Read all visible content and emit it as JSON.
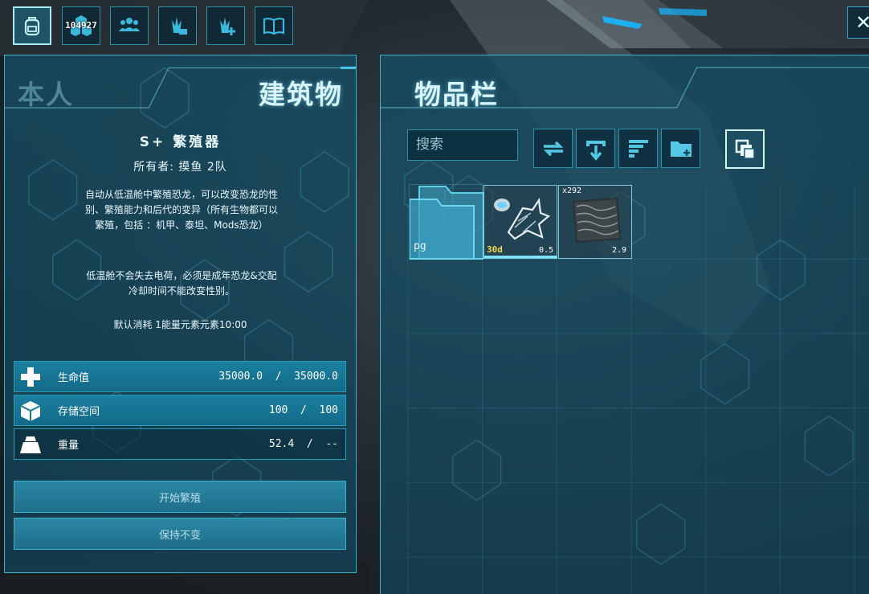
{
  "topbar": {
    "buttons": [
      {
        "name": "inventory-button",
        "icon": "backpack-icon",
        "active": true
      },
      {
        "name": "level-button",
        "icon": "hexagons-icon",
        "text": "104927"
      },
      {
        "name": "tribe-button",
        "icon": "group-icon"
      },
      {
        "name": "tames-button",
        "icon": "plant-folder-icon"
      },
      {
        "name": "engram-button",
        "icon": "plant-plus-icon"
      },
      {
        "name": "notes-button",
        "icon": "book-icon"
      }
    ],
    "close_label": "✕"
  },
  "left_panel": {
    "tab_self": "本人",
    "tab_structure": "建筑物",
    "structure_name": "S+   繁殖器",
    "owner": "所有者:  摸鱼  2队",
    "description_1": "自动从低温舱中繁殖恐龙，可以改变恐龙的性别、繁殖能力和后代的变异（所有生物都可以繁殖，包括 ：机甲、泰坦、Mods恐龙）",
    "description_2": "低温舱不会失去电荷，必须是成年恐龙&交配冷却时间不能改变性别。",
    "cost": "默认消耗  1能量元素元素10:00",
    "stats": [
      {
        "label": "生命值",
        "value": "35000.0  /  35000.0",
        "icon": "plus-icon"
      },
      {
        "label": "存储空间",
        "value": "100  /  100",
        "icon": "box-icon"
      },
      {
        "label": "重量",
        "value": "52.4  /  --",
        "icon": "weight-icon"
      }
    ],
    "buttons": {
      "start_breeding": "开始繁殖",
      "keep_unchanged": "保持不变"
    }
  },
  "right_panel": {
    "title": "物品栏",
    "search_placeholder": "搜索",
    "tools": [
      {
        "name": "transfer-button",
        "icon": "transfer-arrows-icon"
      },
      {
        "name": "drop-button",
        "icon": "drop-icon"
      },
      {
        "name": "sort-button",
        "icon": "sort-bars-icon"
      },
      {
        "name": "new-folder-button",
        "icon": "folder-plus-icon"
      },
      {
        "name": "stack-button",
        "icon": "stack-icon",
        "active": true
      }
    ],
    "folder": {
      "label": "pg"
    },
    "items": [
      {
        "name": "cryopod-item",
        "icon": "cryopod-icon",
        "timer": "30d",
        "weight": "0.5",
        "durability": 1.0
      },
      {
        "name": "resource-item",
        "icon": "chitin-icon",
        "quantity": "x292",
        "weight": "2.9"
      }
    ]
  }
}
